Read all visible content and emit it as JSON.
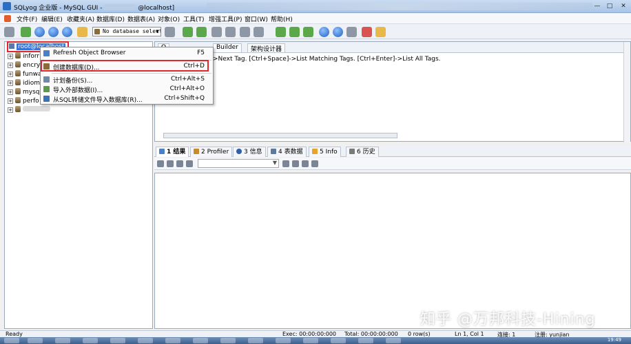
{
  "window": {
    "title": "SQLyog 企业版 - MySQL GUI -",
    "title_suffix": "@localhost]",
    "controls": {
      "minimize": "—",
      "maximize": "□",
      "close": "✕"
    }
  },
  "menu": [
    "文件(F)",
    "编辑(E)",
    "收藏夹(A)",
    "数据库(D)",
    "数据表(A)",
    "对象(O)",
    "工具(T)",
    "增强工具(P)",
    "窗口(W)",
    "帮助(H)"
  ],
  "toolbar": {
    "db_select": "No database select"
  },
  "object_browser": {
    "root_label": "root@localhost",
    "databases": [
      "inforr",
      "encry",
      "funwa",
      "idiom",
      "mysq",
      "perfo",
      ""
    ]
  },
  "context_menu": {
    "items": [
      {
        "label": "Refresh Object Browser",
        "shortcut": "F5",
        "icon_color": "#4a7fc9"
      },
      {
        "label": "创建数据库(D)...",
        "shortcut": "Ctrl+D",
        "icon_color": "#8b6b3a"
      },
      {
        "label": "计划备份(S)...",
        "shortcut": "Ctrl+Alt+S",
        "icon_color": "#6f8aa8"
      },
      {
        "label": "导入外部数据(I)...",
        "shortcut": "Ctrl+Alt+O",
        "icon_color": "#5a9b4a"
      },
      {
        "label": "从SQL转储文件导入数据库(R)...",
        "shortcut": "Ctrl+Shift+Q",
        "icon_color": "#3a72b8"
      }
    ]
  },
  "query_tabs": {
    "tab1": "Q",
    "tab2": "Builder",
    "tab3": "架构设计器"
  },
  "editor_hint": ">Next Tag. [Ctrl+Space]->List Matching Tags. [Ctrl+Enter]->List All Tags.",
  "result_tabs": [
    {
      "num": "1",
      "label": "结果",
      "color": "#4a7fc9"
    },
    {
      "num": "2",
      "label": "Profiler",
      "color": "#c98a2b"
    },
    {
      "num": "3",
      "label": "信息",
      "color": "#2f5fa8"
    },
    {
      "num": "4",
      "label": "表数据",
      "color": "#5c7aa0"
    },
    {
      "num": "5",
      "label": "Info",
      "color": "#e6a42a"
    },
    {
      "num": "6",
      "label": "历史",
      "color": "#7a7a7a"
    }
  ],
  "status": {
    "ready": "Ready",
    "exec": "Exec: 00:00:00:000",
    "total": "Total: 00:00:00:000",
    "rows": "0 row(s)",
    "position": "Ln 1, Col 1",
    "connection": "连接: 1",
    "user": "注册: yunjian"
  },
  "taskbar": {
    "clock": "19:49"
  },
  "watermark": "知乎 @万邦科技-Hining",
  "colors": {
    "highlight_border": "#e2262b",
    "selection": "#3874d6"
  }
}
